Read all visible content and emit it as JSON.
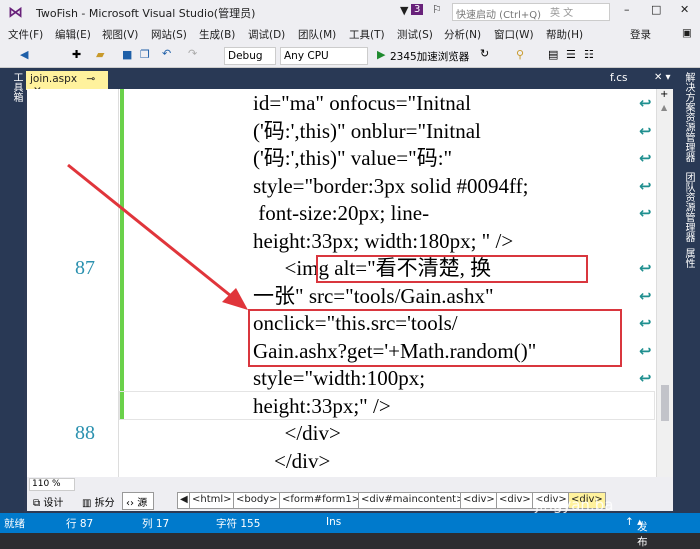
{
  "window": {
    "title": "TwoFish - Microsoft Visual Studio(管理员)",
    "notifications": "3",
    "quick_launch_placeholder": "快速启动 (Ctrl+Q)",
    "ime": "英 文"
  },
  "menu": [
    "文件(F)",
    "编辑(E)",
    "视图(V)",
    "网站(S)",
    "生成(B)",
    "调试(D)",
    "团队(M)",
    "工具(T)",
    "测试(S)",
    "分析(N)",
    "窗口(W)",
    "帮助(H)"
  ],
  "login": "登录",
  "toolbar": {
    "config": "Debug",
    "platform": "Any CPU",
    "run_target": "2345加速浏览器"
  },
  "left_panel": "工具箱",
  "right_panels": [
    "解决方案资源管理器",
    "团队资源管理器",
    "属性"
  ],
  "tabs": {
    "active": "join.aspx",
    "right": "f.cs"
  },
  "editor": {
    "line_numbers": {
      "l87": "87",
      "l88": "88"
    },
    "lines": [
      "id=\"ma\" onfocus=\"Initnal",
      "('码:',this)\" onblur=\"Initnal",
      "('码:',this)\" value=\"码:\"",
      "style=\"border:3px solid #0094ff;",
      " font-size:20px; line-",
      "height:33px; width:180px; \" />",
      "      <img alt=\"看不清楚, 换",
      "一张\" src=\"tools/Gain.ashx\"",
      "onclick=\"this.src='tools/",
      "Gain.ashx?get='+Math.random()\"",
      "style=\"width:100px;",
      "height:33px;\" />",
      "      </div>",
      "    </div>"
    ]
  },
  "zoom": "110 %",
  "views": {
    "design": "设计",
    "split": "拆分",
    "source": "源"
  },
  "breadcrumbs": [
    "<html>",
    "<body>",
    "<form#form1>",
    "<div#maincontent>",
    "<div>",
    "<div>",
    "<div>",
    "<div>"
  ],
  "status": {
    "ready": "就绪",
    "line": "行 87",
    "col": "列 17",
    "char": "字符 155",
    "mode": "Ins",
    "publish": "发布"
  },
  "watermark": "jingyan.ba",
  "colors": {
    "accent": "#007acc",
    "annotation": "#d9363e",
    "active_tab": "#fff29d"
  }
}
